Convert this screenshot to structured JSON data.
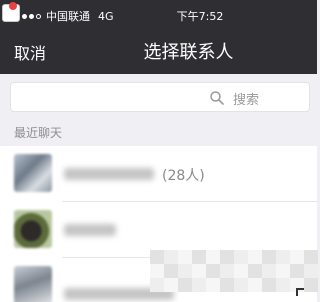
{
  "status_bar": {
    "carrier": "中国联通",
    "network": "4G",
    "time": "下午7:52"
  },
  "nav": {
    "cancel_label": "取消",
    "title": "选择联系人"
  },
  "search": {
    "placeholder": "搜索"
  },
  "section": {
    "recent_label": "最近聊天"
  },
  "chats": [
    {
      "member_count": "(28人)"
    },
    {
      "member_count": ""
    },
    {
      "member_count": ""
    }
  ],
  "colors": {
    "bar_background": "#2f2f33",
    "page_background": "#efeff4"
  }
}
